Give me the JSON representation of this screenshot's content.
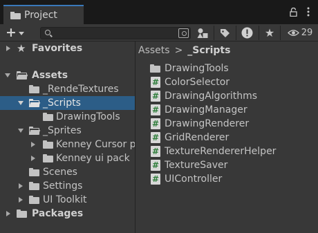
{
  "tab": {
    "title": "Project"
  },
  "toolbar": {
    "search": {
      "value": "",
      "placeholder": ""
    },
    "hidden_count": "29"
  },
  "tree": {
    "favorites": "Favorites",
    "assets": "Assets",
    "items": [
      {
        "label": "_RendeTextures"
      },
      {
        "label": "_Scripts"
      },
      {
        "label": "DrawingTools"
      },
      {
        "label": "_Sprites"
      },
      {
        "label": "Kenney Cursor p"
      },
      {
        "label": "Kenney ui pack"
      },
      {
        "label": "Scenes"
      },
      {
        "label": "Settings"
      },
      {
        "label": "UI Toolkit"
      }
    ],
    "packages": "Packages"
  },
  "breadcrumb": {
    "root": "Assets",
    "current": "_Scripts"
  },
  "files": [
    {
      "label": "DrawingTools",
      "icon": "folder-icon"
    },
    {
      "label": "ColorSelector",
      "icon": "csharp-script-icon"
    },
    {
      "label": "DrawingAlgorithms",
      "icon": "csharp-script-icon"
    },
    {
      "label": "DrawingManager",
      "icon": "csharp-script-icon"
    },
    {
      "label": "DrawingRenderer",
      "icon": "csharp-script-icon"
    },
    {
      "label": "GridRenderer",
      "icon": "csharp-script-icon"
    },
    {
      "label": "TextureRendererHelper",
      "icon": "csharp-script-icon"
    },
    {
      "label": "TextureSaver",
      "icon": "csharp-script-icon"
    },
    {
      "label": "UIController",
      "icon": "csharp-script-icon"
    }
  ],
  "colors": {
    "selection": "#2c5d87",
    "tab_accent": "#3a79bb",
    "panel": "#383838",
    "script_glyph": "#2e7d3a"
  }
}
